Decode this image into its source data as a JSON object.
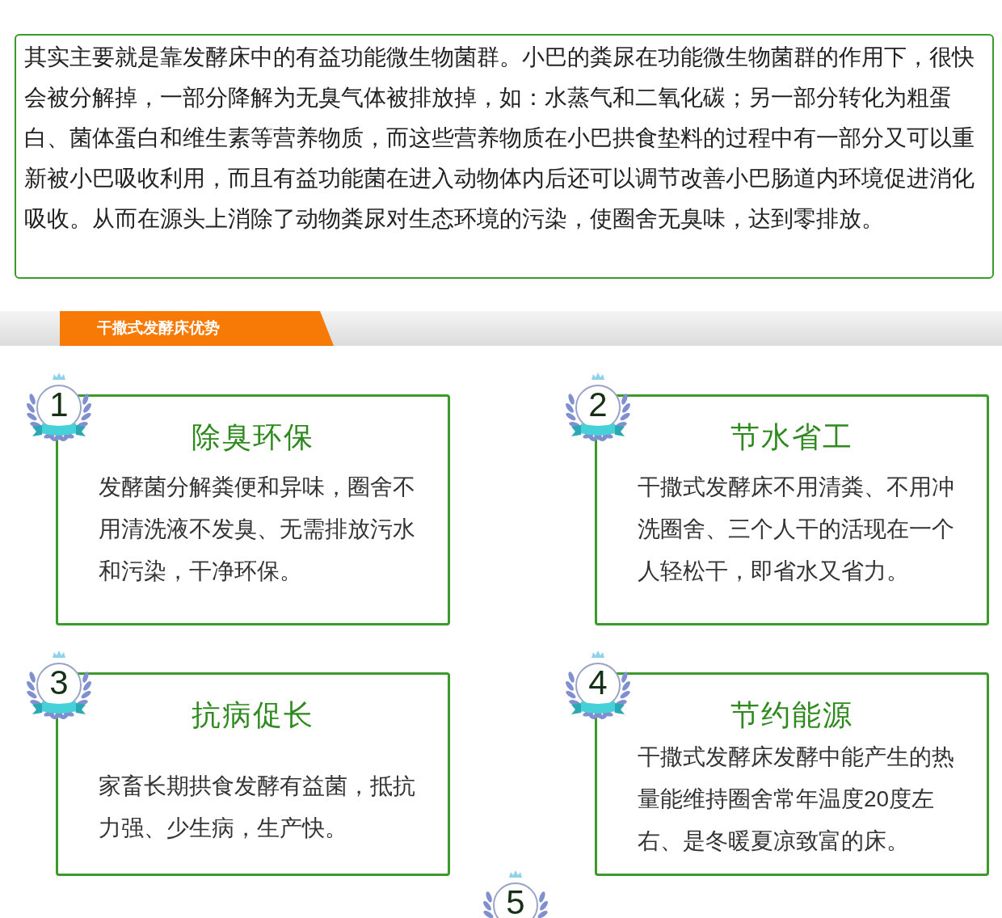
{
  "intro": {
    "text": "其实主要就是靠发酵床中的有益功能微生物菌群。小巴的粪尿在功能微生物菌群的作用下，很快会被分解掉，一部分降解为无臭气体被排放掉，如：水蒸气和二氧化碳；另一部分转化为粗蛋白、菌体蛋白和维生素等营养物质，而这些营养物质在小巴拱食垫料的过程中有一部分又可以重新被小巴吸收利用，而且有益功能菌在进入动物体内后还可以调节改善小巴肠道内环境促进消化吸收。从而在源头上消除了动物粪尿对生态环境的污染，使圈舍无臭味，达到零排放。"
  },
  "section_banner": {
    "title": "干撒式发酵床优势"
  },
  "advantages": [
    {
      "number": "1",
      "title": "除臭环保",
      "text": "发酵菌分解粪便和异味，圈舍不用清洗液不发臭、无需排放污水和污染，干净环保。"
    },
    {
      "number": "2",
      "title": "节水省工",
      "text": "干撒式发酵床不用清粪、不用冲洗圈舍、三个人干的活现在一个人轻松干，即省水又省力。"
    },
    {
      "number": "3",
      "title": "抗病促长",
      "text": "家畜长期拱食发酵有益菌，抵抗力强、少生病，生产快。"
    },
    {
      "number": "4",
      "title": "节约能源",
      "text": "干撒式发酵床发酵中能产生的热量能维持圈舍常年温度20度左右、是冬暖夏凉致富的床。"
    }
  ],
  "next_badge": {
    "number": "5"
  }
}
